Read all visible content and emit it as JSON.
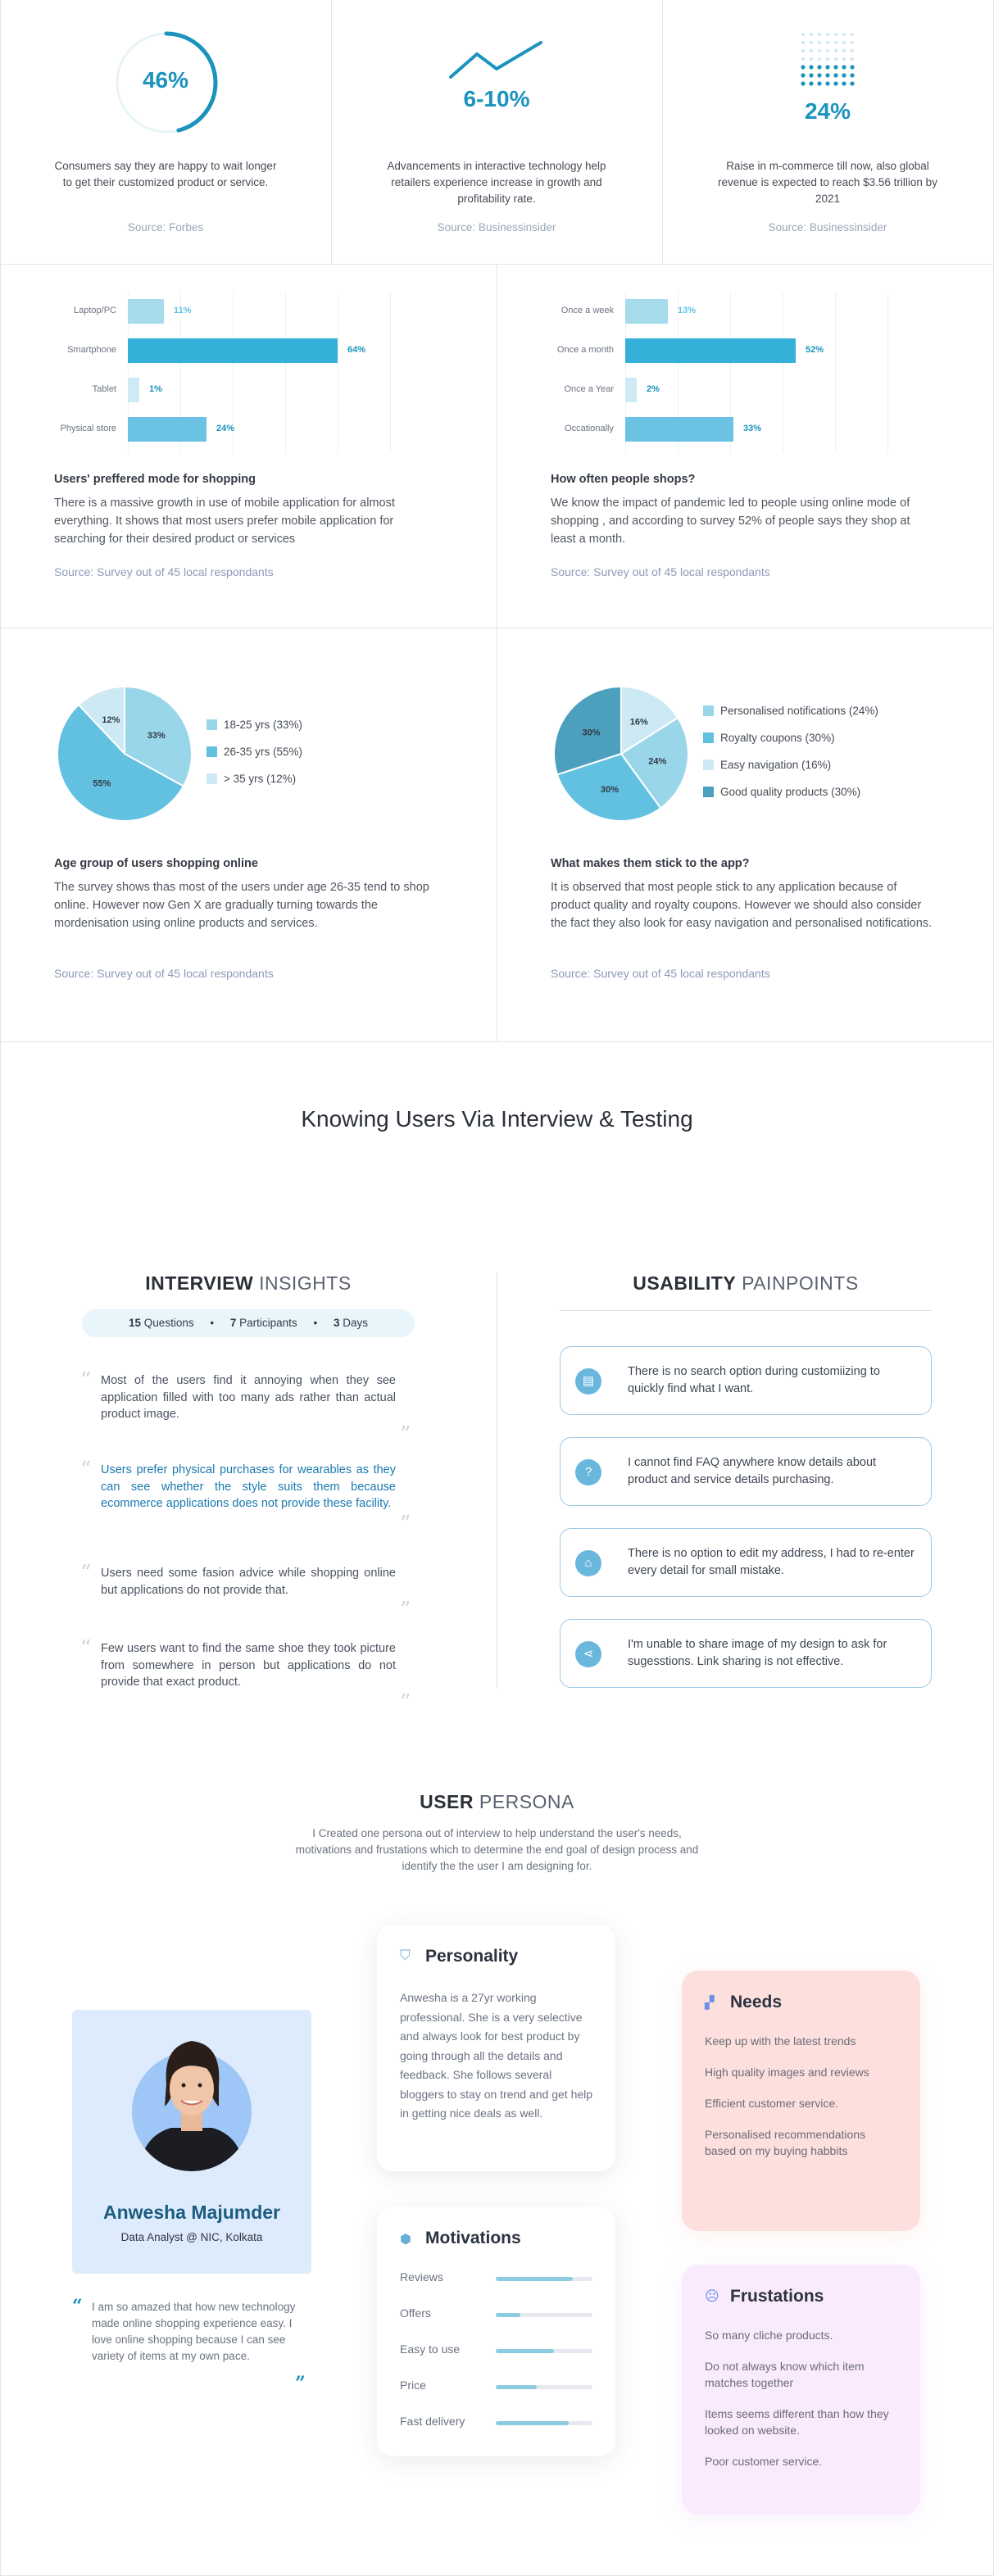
{
  "stats": [
    {
      "value": "46%",
      "desc": "Consumers say they are happy to wait longer to get their customized product or service.",
      "source": "Source: Forbes",
      "ring_percent": 46
    },
    {
      "value": "6-10%",
      "desc": "Advancements in interactive technology help retailers experience increase in growth and profitability rate.",
      "source": "Source: Businessinsider"
    },
    {
      "value": "24%",
      "desc": "Raise in m-commerce till now, also global revenue is expected to reach $3.56 trillion by 2021",
      "source": "Source: Businessinsider"
    }
  ],
  "chart_data": [
    {
      "type": "bar",
      "orientation": "horizontal",
      "categories": [
        "Laptop/PC",
        "Smartphone",
        "Tablet",
        "Physical store"
      ],
      "values": [
        11,
        64,
        1,
        24
      ],
      "value_labels": [
        "11%",
        "64%",
        "1%",
        "24%"
      ],
      "colors": [
        "#a6dbec",
        "#35b1d9",
        "#cdeaf5",
        "#6cc2e2"
      ],
      "label_colors": [
        "#5ec3e6",
        "#1b93bd",
        "#1b93bd",
        "#1b93bd"
      ],
      "xlim": [
        0,
        100
      ],
      "grid": true
    },
    {
      "type": "bar",
      "orientation": "horizontal",
      "categories": [
        "Once a week",
        "Once a month",
        "Once a Year",
        "Occationally"
      ],
      "values": [
        13,
        52,
        2,
        33
      ],
      "value_labels": [
        "13%",
        "52%",
        "2%",
        "33%"
      ],
      "colors": [
        "#a6dbec",
        "#35b1d9",
        "#cdeaf5",
        "#6cc2e2"
      ],
      "label_colors": [
        "#5ec3e6",
        "#1b93bd",
        "#1b93bd",
        "#1b93bd"
      ],
      "xlim": [
        0,
        100
      ],
      "grid": true
    },
    {
      "type": "pie",
      "labels": [
        "18-25 yrs (33%)",
        "26-35 yrs (55%)",
        "> 35 yrs (12%)"
      ],
      "values": [
        33,
        55,
        12
      ],
      "value_labels": [
        "33%",
        "55%",
        "12%"
      ],
      "colors": [
        "#9ad6ea",
        "#62c0e0",
        "#cdeaf4"
      ],
      "legend": "right"
    },
    {
      "type": "pie",
      "labels": [
        "Personalised notifications (24%)",
        "Royalty coupons (30%)",
        "Easy navigation (16%)",
        "Good quality products (30%)"
      ],
      "values": [
        24,
        30,
        16,
        30
      ],
      "value_labels": [
        "24%",
        "30%",
        "16%",
        "30%"
      ],
      "colors": [
        "#9ad6ea",
        "#62c0e0",
        "#cdeaf4",
        "#4d9fbe"
      ],
      "legend": "right"
    }
  ],
  "insights": [
    {
      "title": "Users' preffered mode for shopping",
      "desc": "There is a massive growth in use of mobile application for almost everything. It shows that most users prefer mobile application for searching for their desired product or services",
      "source": "Source: Survey out of 45 local respondants"
    },
    {
      "title": "How often people shops?",
      "desc": "We know the impact of pandemic led to people using online mode of shopping , and according to survey 52% of people says they shop at least a month.",
      "source": "Source: Survey out of 45 local respondants"
    },
    {
      "title": "Age group of users shopping online",
      "desc": "The survey shows thas most of the users under age 26-35 tend to shop online. However now Gen X are gradually turning towards the mordenisation using online products and services.",
      "source": "Source: Survey out of 45 local respondants"
    },
    {
      "title": "What makes them stick to the app?",
      "desc": "It is observed that most people stick to any application because of product quality and royalty coupons. However we should also consider the fact they also look for easy navigation and personalised notifications.",
      "source": "Source: Survey out of 45 local respondants"
    }
  ],
  "section_title": "Knowing Users Via Interview & Testing",
  "interview": {
    "title_bold": "INTERVIEW",
    "title_light": "INSIGHTS",
    "questions_num": "15",
    "questions_label": "Questions",
    "participants_num": "7",
    "participants_label": "Participants",
    "days_num": "3",
    "days_label": "Days",
    "quotes": [
      {
        "text": "Most of the users find it annoying when they see application filled with too many ads rather than actual product image.",
        "highlight": false
      },
      {
        "text": "Users prefer physical purchases for wearables as they can see whether the style suits them because ecommerce applications does not provide these facility.",
        "highlight": true
      },
      {
        "text": "Users need some fasion advice while shopping online but applications do not provide that.",
        "highlight": false
      },
      {
        "text": "Few users want to find the same shoe they took picture from somewhere in person but applications do not provide that exact product.",
        "highlight": false
      }
    ]
  },
  "usability": {
    "title_bold": "USABILITY",
    "title_light": "PAINPOINTS",
    "items": [
      {
        "icon": "search-icon",
        "text": "There is no search option during customiizing to quickly find what I want."
      },
      {
        "icon": "faq-icon",
        "text": "I cannot find FAQ anywhere know details about product and service details purchasing."
      },
      {
        "icon": "home-icon",
        "text": "There is no option to edit my address, I had to re-enter every detail for small mistake."
      },
      {
        "icon": "share-icon",
        "text": "I'm unable to share image of my design to ask for sugesstions. Link sharing is not effective."
      }
    ]
  },
  "persona": {
    "title_bold": "USER",
    "title_light": "PERSONA",
    "intro": "I Created one persona out of interview to help understand the user's needs, motivations and frustations which to determine the end goal of design process and identify the the user I am designing for.",
    "name": "Anwesha Majumder",
    "role": "Data Analyst @ NIC, Kolkata",
    "quote": "I am so amazed that how new technology made online shopping experience easy. I love online shopping because I can see variety of items at my own pace.",
    "personality_title": "Personality",
    "personality_text": "Anwesha is a 27yr working professional. She is a very selective and always look for best product by going through all the details and feedback. She follows several bloggers to stay on trend and get help in getting nice deals as well.",
    "motivations_title": "Motivations",
    "motivations": [
      {
        "label": "Reviews",
        "level": 0.8
      },
      {
        "label": "Offers",
        "level": 0.25
      },
      {
        "label": "Easy to use",
        "level": 0.6
      },
      {
        "label": "Price",
        "level": 0.42
      },
      {
        "label": "Fast delivery",
        "level": 0.75
      }
    ],
    "needs_title": "Needs",
    "needs": [
      "Keep up with the latest trends",
      "High quality images and reviews",
      "Efficient customer service.",
      "Personalised recommendations based on my buying habbits"
    ],
    "frustrations_title": "Frustations",
    "frustrations": [
      "So many cliche products.",
      "Do not always know which item matches together",
      "Items seems different than how they looked on website.",
      "Poor customer service."
    ]
  }
}
